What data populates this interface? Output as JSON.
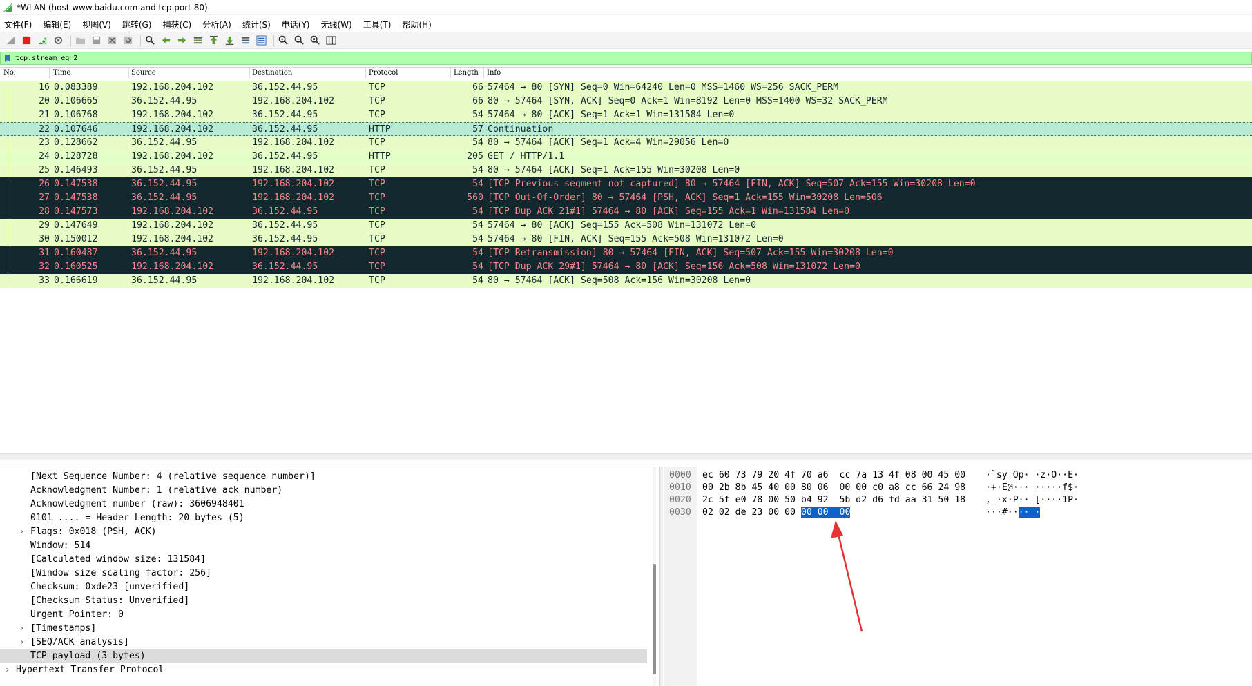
{
  "window": {
    "title": "*WLAN (host www.baidu.com and tcp port 80)"
  },
  "menu": [
    "文件(F)",
    "编辑(E)",
    "视图(V)",
    "跳转(G)",
    "捕获(C)",
    "分析(A)",
    "统计(S)",
    "电话(Y)",
    "无线(W)",
    "工具(T)",
    "帮助(H)"
  ],
  "toolbar": {
    "icons": [
      "shark-fin-start-icon",
      "stop-icon",
      "restart-icon",
      "options-icon",
      "open-icon",
      "save-icon",
      "close-file-icon",
      "reload-icon",
      "find-icon",
      "back-icon",
      "forward-icon",
      "goto-icon",
      "first-icon",
      "last-icon",
      "autoscroll-icon",
      "colorize-icon",
      "zoom-in-icon",
      "zoom-out-icon",
      "zoom-normal-icon",
      "resize-columns-icon"
    ]
  },
  "filter": {
    "value": "tcp.stream eq 2"
  },
  "packet_list": {
    "columns": [
      "No.",
      "Time",
      "Source",
      "Destination",
      "Protocol",
      "Length",
      "Info"
    ],
    "rows": [
      {
        "no": "16",
        "time": "0.083389",
        "src": "192.168.204.102",
        "dst": "36.152.44.95",
        "proto": "TCP",
        "len": "66",
        "info": "57464 → 80 [SYN] Seq=0 Win=64240 Len=0 MSS=1460 WS=256 SACK_PERM",
        "style": "tcp"
      },
      {
        "no": "20",
        "time": "0.106665",
        "src": "36.152.44.95",
        "dst": "192.168.204.102",
        "proto": "TCP",
        "len": "66",
        "info": "80 → 57464 [SYN, ACK] Seq=0 Ack=1 Win=8192 Len=0 MSS=1400 WS=32 SACK_PERM",
        "style": "tcp"
      },
      {
        "no": "21",
        "time": "0.106768",
        "src": "192.168.204.102",
        "dst": "36.152.44.95",
        "proto": "TCP",
        "len": "54",
        "info": "57464 → 80 [ACK] Seq=1 Ack=1 Win=131584 Len=0",
        "style": "tcp"
      },
      {
        "no": "22",
        "time": "0.107646",
        "src": "192.168.204.102",
        "dst": "36.152.44.95",
        "proto": "HTTP",
        "len": "57",
        "info": "Continuation",
        "style": "sel"
      },
      {
        "no": "23",
        "time": "0.128662",
        "src": "36.152.44.95",
        "dst": "192.168.204.102",
        "proto": "TCP",
        "len": "54",
        "info": "80 → 57464 [ACK] Seq=1 Ack=4 Win=29056 Len=0",
        "style": "tcp"
      },
      {
        "no": "24",
        "time": "0.128728",
        "src": "192.168.204.102",
        "dst": "36.152.44.95",
        "proto": "HTTP",
        "len": "205",
        "info": "GET / HTTP/1.1",
        "style": "http"
      },
      {
        "no": "25",
        "time": "0.146493",
        "src": "36.152.44.95",
        "dst": "192.168.204.102",
        "proto": "TCP",
        "len": "54",
        "info": "80 → 57464 [ACK] Seq=1 Ack=155 Win=30208 Len=0",
        "style": "tcp"
      },
      {
        "no": "26",
        "time": "0.147538",
        "src": "36.152.44.95",
        "dst": "192.168.204.102",
        "proto": "TCP",
        "len": "54",
        "info": "[TCP Previous segment not captured] 80 → 57464 [FIN, ACK] Seq=507 Ack=155 Win=30208 Len=0",
        "style": "bad"
      },
      {
        "no": "27",
        "time": "0.147538",
        "src": "36.152.44.95",
        "dst": "192.168.204.102",
        "proto": "TCP",
        "len": "560",
        "info": "[TCP Out-Of-Order] 80 → 57464 [PSH, ACK] Seq=1 Ack=155 Win=30208 Len=506",
        "style": "bad"
      },
      {
        "no": "28",
        "time": "0.147573",
        "src": "192.168.204.102",
        "dst": "36.152.44.95",
        "proto": "TCP",
        "len": "54",
        "info": "[TCP Dup ACK 21#1] 57464 → 80 [ACK] Seq=155 Ack=1 Win=131584 Len=0",
        "style": "bad"
      },
      {
        "no": "29",
        "time": "0.147649",
        "src": "192.168.204.102",
        "dst": "36.152.44.95",
        "proto": "TCP",
        "len": "54",
        "info": "57464 → 80 [ACK] Seq=155 Ack=508 Win=131072 Len=0",
        "style": "tcp"
      },
      {
        "no": "30",
        "time": "0.150012",
        "src": "192.168.204.102",
        "dst": "36.152.44.95",
        "proto": "TCP",
        "len": "54",
        "info": "57464 → 80 [FIN, ACK] Seq=155 Ack=508 Win=131072 Len=0",
        "style": "tcp"
      },
      {
        "no": "31",
        "time": "0.160487",
        "src": "36.152.44.95",
        "dst": "192.168.204.102",
        "proto": "TCP",
        "len": "54",
        "info": "[TCP Retransmission] 80 → 57464 [FIN, ACK] Seq=507 Ack=155 Win=30208 Len=0",
        "style": "bad"
      },
      {
        "no": "32",
        "time": "0.160525",
        "src": "192.168.204.102",
        "dst": "36.152.44.95",
        "proto": "TCP",
        "len": "54",
        "info": "[TCP Dup ACK 29#1] 57464 → 80 [ACK] Seq=156 Ack=508 Win=131072 Len=0",
        "style": "bad"
      },
      {
        "no": "33",
        "time": "0.166619",
        "src": "36.152.44.95",
        "dst": "192.168.204.102",
        "proto": "TCP",
        "len": "54",
        "info": "80 → 57464 [ACK] Seq=508 Ack=156 Win=30208 Len=0",
        "style": "tcp"
      }
    ]
  },
  "details": {
    "rows": [
      {
        "text": "[Next Sequence Number: 4    (relative sequence number)]",
        "level": 2,
        "expander": false,
        "selected": false
      },
      {
        "text": "Acknowledgment Number: 1    (relative ack number)",
        "level": 2,
        "expander": false,
        "selected": false
      },
      {
        "text": "Acknowledgment number (raw): 3606948401",
        "level": 2,
        "expander": false,
        "selected": false
      },
      {
        "text": "0101 .... = Header Length: 20 bytes (5)",
        "level": 2,
        "expander": false,
        "selected": false
      },
      {
        "text": "Flags: 0x018 (PSH, ACK)",
        "level": 2,
        "expander": true,
        "selected": false
      },
      {
        "text": "Window: 514",
        "level": 2,
        "expander": false,
        "selected": false
      },
      {
        "text": "[Calculated window size: 131584]",
        "level": 2,
        "expander": false,
        "selected": false
      },
      {
        "text": "[Window size scaling factor: 256]",
        "level": 2,
        "expander": false,
        "selected": false
      },
      {
        "text": "Checksum: 0xde23 [unverified]",
        "level": 2,
        "expander": false,
        "selected": false
      },
      {
        "text": "[Checksum Status: Unverified]",
        "level": 2,
        "expander": false,
        "selected": false
      },
      {
        "text": "Urgent Pointer: 0",
        "level": 2,
        "expander": false,
        "selected": false
      },
      {
        "text": "[Timestamps]",
        "level": 2,
        "expander": true,
        "selected": false
      },
      {
        "text": "[SEQ/ACK analysis]",
        "level": 2,
        "expander": true,
        "selected": false
      },
      {
        "text": "TCP payload (3 bytes)",
        "level": 2,
        "expander": false,
        "selected": true
      },
      {
        "text": "Hypertext Transfer Protocol",
        "level": 1,
        "expander": true,
        "selected": false
      }
    ]
  },
  "bytes": {
    "rows": [
      {
        "offset": "0000",
        "hex_pre": "ec 60 73 79 20 4f 70 a6  cc 7a 13 4f 08 00 45 00",
        "hex_sel": "",
        "hex_post": "",
        "ascii_pre": "·`sy Op· ·z·O··E·",
        "ascii_sel": "",
        "ascii_post": ""
      },
      {
        "offset": "0010",
        "hex_pre": "00 2b 8b 45 40 00 80 06  00 00 c0 a8 cc 66 24 98",
        "hex_sel": "",
        "hex_post": "",
        "ascii_pre": "·+·E@··· ·····f$·",
        "ascii_sel": "",
        "ascii_post": ""
      },
      {
        "offset": "0020",
        "hex_pre": "2c 5f e0 78 00 50 b4 92  5b d2 d6 fd aa 31 50 18",
        "hex_sel": "",
        "hex_post": "",
        "ascii_pre": ",_·x·P·· [····1P·",
        "ascii_sel": "",
        "ascii_post": ""
      },
      {
        "offset": "0030",
        "hex_pre": "02 02 de 23 00 00 ",
        "hex_sel": "00 00  00",
        "hex_post": "",
        "ascii_pre": "···#··",
        "ascii_sel": "·· ·",
        "ascii_post": ""
      }
    ]
  }
}
